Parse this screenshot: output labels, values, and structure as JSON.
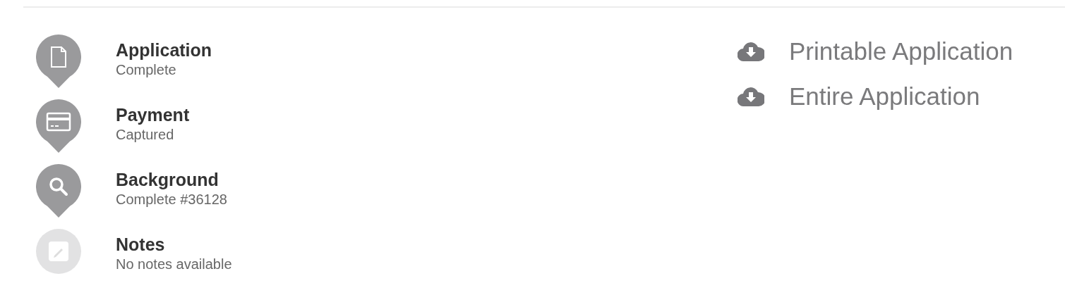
{
  "steps": [
    {
      "kind": "document",
      "title": "Application",
      "status": "Complete",
      "active": true
    },
    {
      "kind": "card",
      "title": "Payment",
      "status": "Captured",
      "active": true
    },
    {
      "kind": "search",
      "title": "Background",
      "status": "Complete #36128",
      "active": true
    },
    {
      "kind": "pencil",
      "title": "Notes",
      "status": "No notes available",
      "active": false
    }
  ],
  "downloads": [
    {
      "label": "Printable Application"
    },
    {
      "label": "Entire Application"
    }
  ]
}
